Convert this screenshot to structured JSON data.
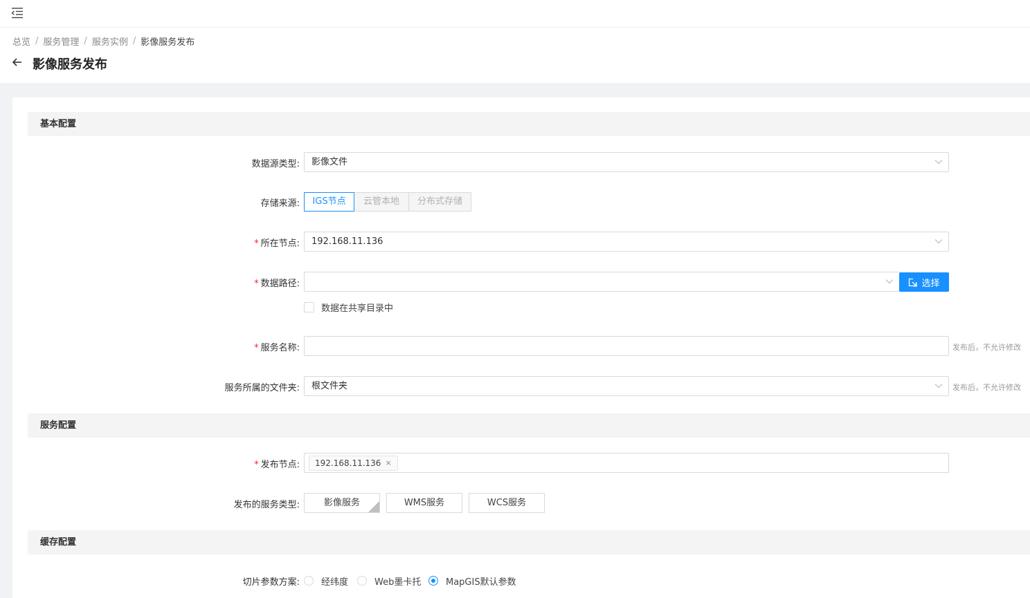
{
  "breadcrumb": {
    "items": [
      "总览",
      "服务管理",
      "服务实例"
    ],
    "separator": "/",
    "current": "影像服务发布"
  },
  "page": {
    "title": "影像服务发布"
  },
  "sections": {
    "basic": "基本配置",
    "service": "服务配置",
    "cache": "缓存配置"
  },
  "form": {
    "datasource_type": {
      "label": "数据源类型:",
      "value": "影像文件"
    },
    "storage_source": {
      "label": "存储来源:",
      "options": [
        "IGS节点",
        "云管本地",
        "分布式存储"
      ],
      "selected": "IGS节点"
    },
    "node": {
      "required": "*",
      "label": "所在节点:",
      "value": "192.168.11.136"
    },
    "data_path": {
      "required": "*",
      "label": "数据路径:",
      "value": "",
      "button": "选择"
    },
    "shared_dir": {
      "label": "数据在共享目录中",
      "checked": false
    },
    "service_name": {
      "required": "*",
      "label": "服务名称:",
      "value": "",
      "hint": "发布后，不允许修改"
    },
    "folder": {
      "label": "服务所属的文件夹:",
      "value": "根文件夹",
      "hint": "发布后，不允许修改"
    },
    "publish_node": {
      "required": "*",
      "label": "发布节点:",
      "tags": [
        "192.168.11.136"
      ],
      "remove": "×"
    },
    "service_types": {
      "label": "发布的服务类型:",
      "options": [
        "影像服务",
        "WMS服务",
        "WCS服务"
      ],
      "selected": "影像服务"
    },
    "tile_scheme": {
      "label": "切片参数方案:",
      "options": [
        "经纬度",
        "Web墨卡托",
        "MapGIS默认参数"
      ],
      "selected": "MapGIS默认参数"
    }
  },
  "colors": {
    "primary": "#1890ff",
    "required": "#f5222d",
    "page_bg": "#f0f2f5",
    "section_bg": "#f4f4f5"
  }
}
